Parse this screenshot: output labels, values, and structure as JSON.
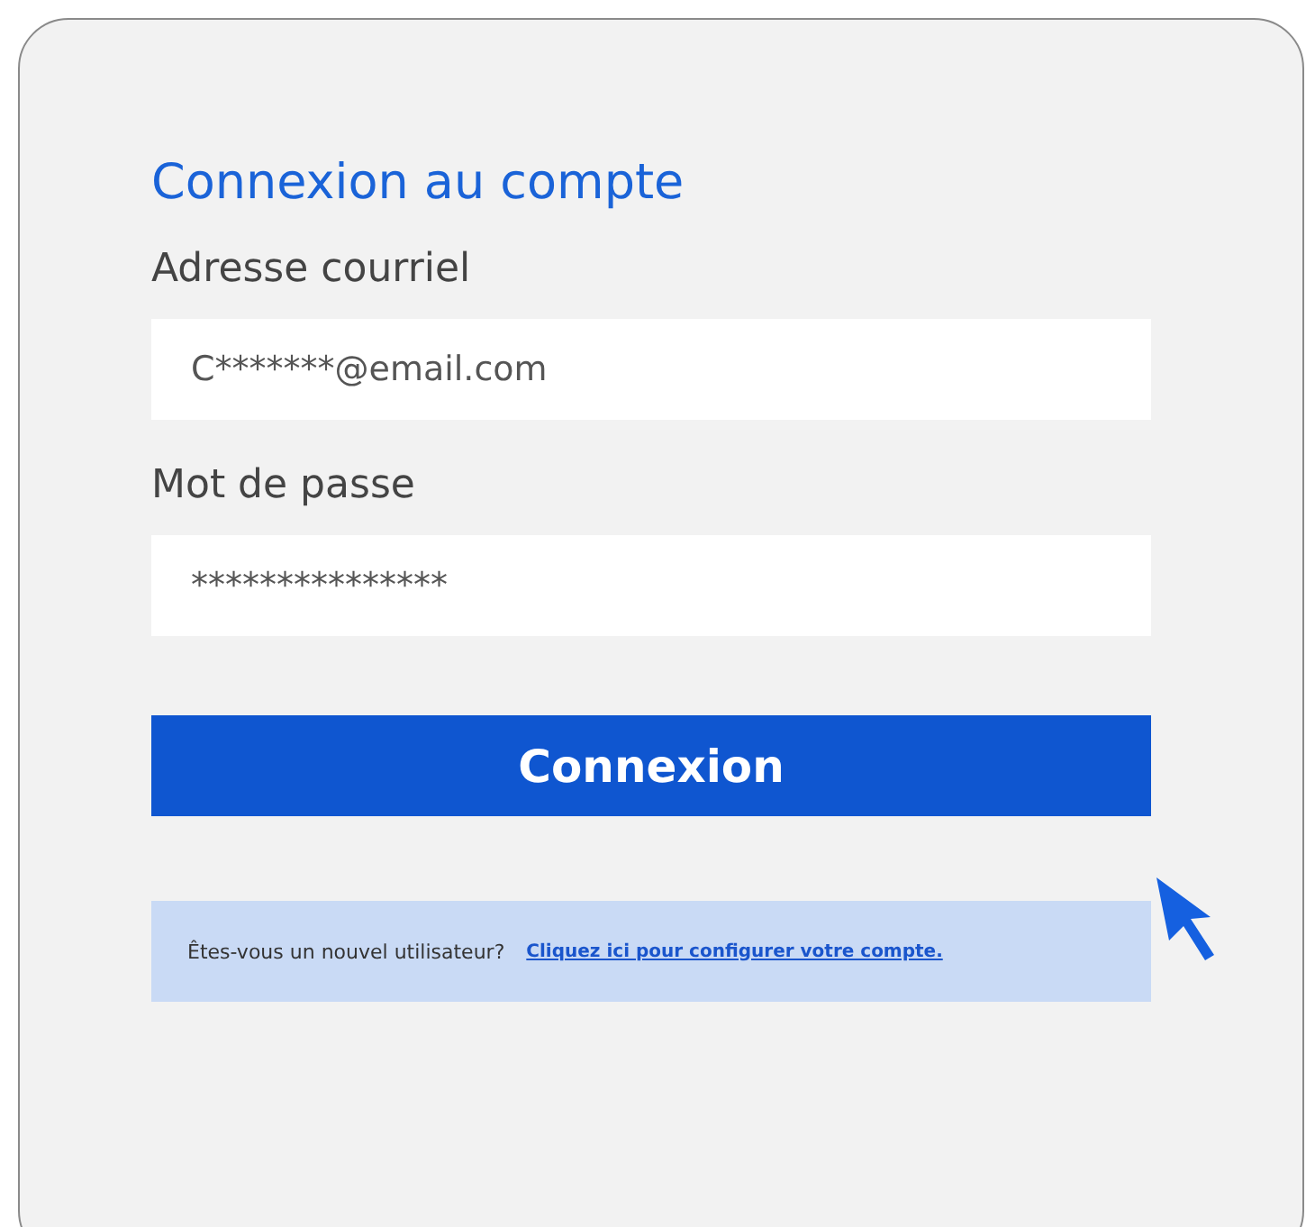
{
  "title": "Connexion au compte",
  "fields": [
    {
      "label": "Adresse courriel",
      "value": "C*******@email.com"
    },
    {
      "label": "Mot de passe",
      "value": "***************"
    }
  ],
  "submit_button": "Connexion",
  "signup": {
    "text": "Êtes-vous un nouvel utilisateur?",
    "link": "Cliquez ici pour configurer votre compte."
  }
}
